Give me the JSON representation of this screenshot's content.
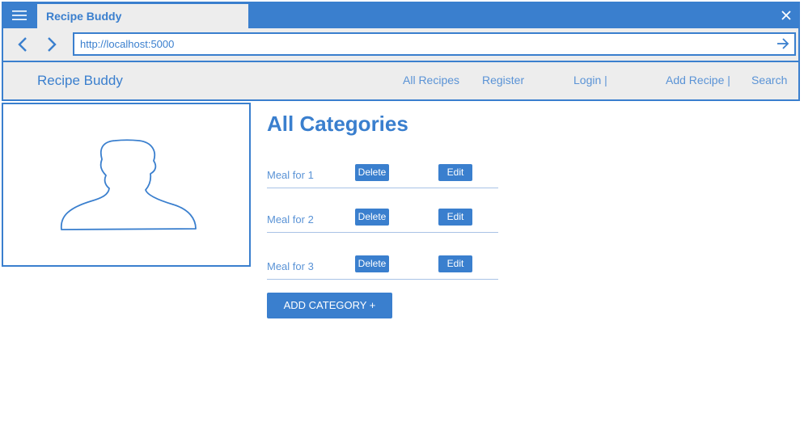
{
  "window": {
    "tab_title": "Recipe Buddy",
    "menu_icon": "hamburger-icon",
    "close_icon": "close-icon"
  },
  "addressbar": {
    "url": "http://localhost:5000",
    "back_icon": "chevron-left-icon",
    "forward_icon": "chevron-right-icon",
    "go_icon": "arrow-right-icon"
  },
  "navbar": {
    "brand": "Recipe Buddy",
    "links": [
      "All Recipes",
      "Register",
      "Login |",
      "Add Recipe |",
      "Search"
    ]
  },
  "image": {
    "icon": "user-silhouette-icon"
  },
  "main": {
    "title": "All Categories",
    "categories": [
      {
        "name": "Meal for 1",
        "delete_label": "Delete",
        "edit_label": "Edit"
      },
      {
        "name": "Meal for 2",
        "delete_label": "Delete",
        "edit_label": "Edit"
      },
      {
        "name": "Meal for 3",
        "delete_label": "Delete",
        "edit_label": "Edit"
      }
    ],
    "add_label": "ADD CATEGORY +"
  },
  "colors": {
    "accent": "#3a7fce",
    "link": "#5a93d6",
    "chrome_bg": "#ededed",
    "divider": "#a9c3e6"
  }
}
